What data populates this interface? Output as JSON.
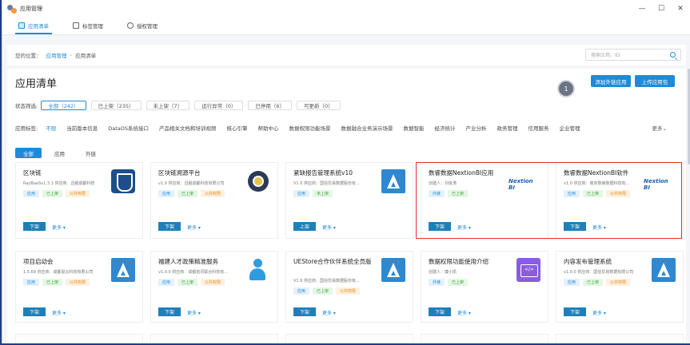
{
  "window": {
    "title": "应用管理",
    "controls": [
      "—",
      "☐",
      "✕"
    ]
  },
  "tabs": [
    {
      "label": "应用清单",
      "active": true
    },
    {
      "label": "标签管理",
      "active": false
    },
    {
      "label": "授权管理",
      "active": false
    }
  ],
  "breadcrumb": {
    "prefix": "您的位置：",
    "items": [
      "应用管理",
      "应用清单"
    ],
    "sep": "›"
  },
  "search": {
    "placeholder": "搜索应用、ID"
  },
  "page": {
    "title": "应用清单",
    "add_button": "添加外链应用",
    "upload_button": "上传应用包",
    "step_badge": "1"
  },
  "status_filter": {
    "label": "状态筛选:",
    "chips": [
      "全部（242）",
      "已上架（235）",
      "未上架（7）",
      "运行异常（0）",
      "已停用（6）",
      "可更新（0）"
    ]
  },
  "tag_filter": {
    "label": "应用标签:",
    "items": [
      "不限",
      "当前版本信息",
      "DataOS系统接口",
      "产品相关文档和培训视频",
      "核心引擎",
      "帮助中心",
      "数据权限功能场景",
      "数据融合业务演示场景",
      "数据智能",
      "经济统计",
      "产业分析",
      "政务管理",
      "信用服务",
      "企业管理"
    ],
    "more": "更多⌄"
  },
  "subtabs": [
    "全部",
    "应用",
    "外链"
  ],
  "cards": [
    {
      "title": "区块链",
      "info": "RayBaaSv1.3.1    供应商：迅鲲成都科技",
      "tags": [
        "应用",
        "已上架",
        "公共权限"
      ],
      "btn1": "下架",
      "btn2": "更多 ▾",
      "icon": "shield-app-icon"
    },
    {
      "title": "区块链溯源平台",
      "info": "v1.0    供应商：迅鲲成都科技有限公司",
      "tags": [
        "应用",
        "已上架",
        "公共权限"
      ],
      "btn1": "下架",
      "btn2": "更多 ▾",
      "icon": "chain-circle-icon"
    },
    {
      "title": "紧缺报告管理系统v10",
      "info": "V1.0    供应商：国信优易数据股份有...",
      "tags": [
        "应用",
        "未上架"
      ],
      "btn1": "上架",
      "btn2": "更多 ▾",
      "icon": "app-a-icon"
    },
    {
      "title": "数睿数据NextionBI应用",
      "info": "创建人：刘俊涛",
      "tags": [
        "外链",
        "已上架"
      ],
      "btn1": "下架",
      "btn2": "更多 ▾",
      "icon": "nextion-logo-icon",
      "logo_text": "Nextion BI"
    },
    {
      "title": "数睿数据NextionBI软件",
      "info": "v1.0    供应商：南京数睿数据科技有...",
      "tags": [
        "应用",
        "已上架",
        "公共权限"
      ],
      "btn1": "下架",
      "btn2": "更多 ▾",
      "icon": "nextion-logo-icon",
      "logo_text": "Nextion BI"
    },
    {
      "title": "项目启动会",
      "info": "1.5.69    供应商：成都鼠云科技有限公司",
      "tags": [
        "应用",
        "已上架",
        "公共权限"
      ],
      "btn1": "下架",
      "btn2": "更多 ▾",
      "icon": "app-a-icon"
    },
    {
      "title": "福建人才政策精准服务",
      "info": "v1.0.0    供应商：成都拓讯联合科技有...",
      "tags": [
        "应用",
        "已上架",
        "公共权限"
      ],
      "btn1": "下架",
      "btn2": "更多 ▾",
      "icon": "person-app-icon"
    },
    {
      "title": "UEStore合作伙伴系统全员版",
      "info": "V1.6    供应商：国信优易数据股份有...",
      "tags": [
        "应用",
        "已上架",
        "公共权限"
      ],
      "btn1": "下架",
      "btn2": "更多 ▾",
      "icon": "app-a-icon"
    },
    {
      "title": "数据权限功能使用介绍",
      "info": "创建人：廉小凯",
      "tags": [
        "外链",
        "已上架"
      ],
      "btn1": "下架",
      "btn2": "更多 ▾",
      "icon": "code-app-icon"
    },
    {
      "title": "内容发布管理系统",
      "info": "v1.0.0    供应商：国信优易数据有限公司",
      "tags": [
        "应用",
        "已上架",
        "公共权限"
      ],
      "btn1": "下架",
      "btn2": "更多 ▾",
      "icon": "app-a-icon"
    }
  ]
}
